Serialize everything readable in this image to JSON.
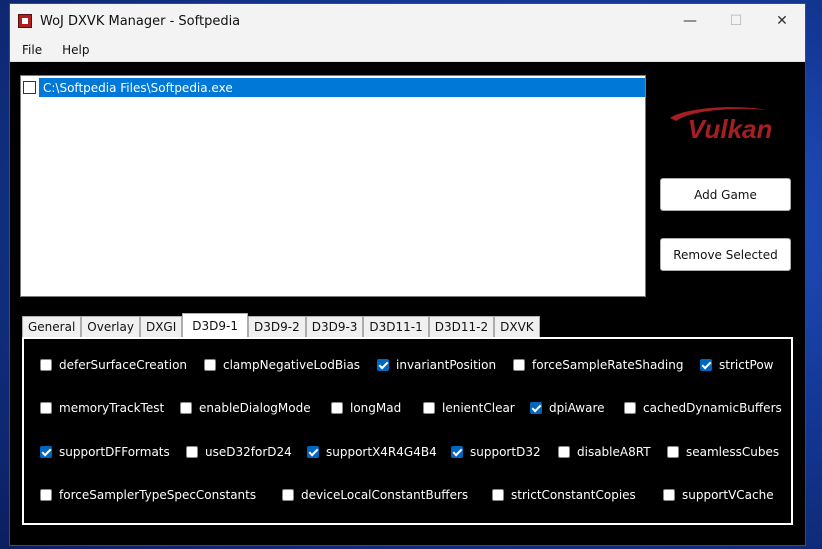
{
  "window": {
    "title": "WoJ DXVK Manager - Softpedia",
    "controls": {
      "minimize": "—",
      "maximize": "☐",
      "close": "✕"
    }
  },
  "menu": [
    "File",
    "Help"
  ],
  "games": [
    {
      "path": "C:\\Softpedia Files\\Softpedia.exe",
      "checked": false,
      "selected": true
    }
  ],
  "logo": {
    "text": "Vulkan",
    "color": "#a41e22"
  },
  "buttons": {
    "add_game": "Add Game",
    "remove_selected": "Remove Selected"
  },
  "tabs": [
    {
      "label": "General",
      "active": false
    },
    {
      "label": "Overlay",
      "active": false
    },
    {
      "label": "DXGI",
      "active": false
    },
    {
      "label": "D3D9-1",
      "active": true
    },
    {
      "label": "D3D9-2",
      "active": false
    },
    {
      "label": "D3D9-3",
      "active": false
    },
    {
      "label": "D3D11-1",
      "active": false
    },
    {
      "label": "D3D11-2",
      "active": false
    },
    {
      "label": "DXVK",
      "active": false
    }
  ],
  "options": [
    {
      "label": "deferSurfaceCreation",
      "checked": false
    },
    {
      "label": "clampNegativeLodBias",
      "checked": false
    },
    {
      "label": "invariantPosition",
      "checked": true
    },
    {
      "label": "forceSampleRateShading",
      "checked": false
    },
    {
      "label": "strictPow",
      "checked": true
    },
    {
      "label": "memoryTrackTest",
      "checked": false
    },
    {
      "label": "enableDialogMode",
      "checked": false
    },
    {
      "label": "longMad",
      "checked": false
    },
    {
      "label": "lenientClear",
      "checked": false
    },
    {
      "label": "dpiAware",
      "checked": true
    },
    {
      "label": "cachedDynamicBuffers",
      "checked": false
    },
    {
      "label": "supportDFFormats",
      "checked": true
    },
    {
      "label": "useD32forD24",
      "checked": false
    },
    {
      "label": "supportX4R4G4B4",
      "checked": true
    },
    {
      "label": "supportD32",
      "checked": true
    },
    {
      "label": "disableA8RT",
      "checked": false
    },
    {
      "label": "seamlessCubes",
      "checked": false
    },
    {
      "label": "forceSamplerTypeSpecConstants",
      "checked": false
    },
    {
      "label": "deviceLocalConstantBuffers",
      "checked": false
    },
    {
      "label": "strictConstantCopies",
      "checked": false
    },
    {
      "label": "supportVCache",
      "checked": false
    }
  ],
  "colors": {
    "accent": "#0078d7",
    "checkbox_on": "#0067c0"
  }
}
